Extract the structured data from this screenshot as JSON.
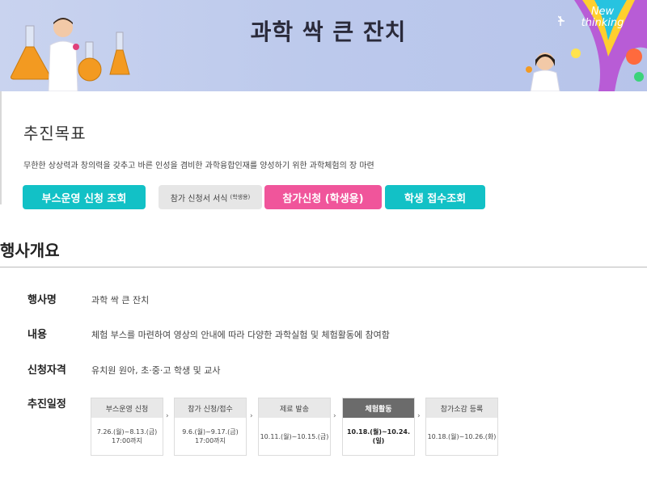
{
  "banner": {
    "title": "과학 싹 큰 잔치",
    "badge_line1": "New",
    "badge_line2": "thinking"
  },
  "goal": {
    "heading": "추진목표",
    "text": "무한한 상상력과 창의력을 갖추고 바른 인성을 겸비한 과학융합인재를 양성하기 위한 과학체험의 장 마련"
  },
  "buttons": {
    "booth": "부스운영 신청 조회",
    "form": "참가 신청서 서식",
    "form_small": "(학생용)",
    "apply": "참가신청 (학생용)",
    "check": "학생 접수조회"
  },
  "overview": {
    "heading": "행사개요",
    "rows": [
      {
        "label": "행사명",
        "value": "과학 싹 큰 잔치"
      },
      {
        "label": "내용",
        "value": "체험 부스를 마련하여 영상의 안내에 따라 다양한 과학실험 및 체험활동에 참여함"
      },
      {
        "label": "신청자격",
        "value": "유치원 원아, 초·중·고 학생 및 교사"
      },
      {
        "label": "추진일정",
        "value": ""
      }
    ]
  },
  "schedule": [
    {
      "title": "부스운영 신청",
      "line1": "7.26.(월)~8.13.(금)",
      "line2": "17:00까지",
      "active": false
    },
    {
      "title": "참가 신청/접수",
      "line1": "9.6.(월)~9.17.(금)",
      "line2": "17:00까지",
      "active": false
    },
    {
      "title": "제료 발송",
      "line1": "10.11.(월)~10.15.(금)",
      "line2": "",
      "active": false
    },
    {
      "title": "체험활동",
      "line1": "10.18.(월)~10.24.(일)",
      "line2": "",
      "active": true
    },
    {
      "title": "참가소감 등록",
      "line1": "10.18.(월)~10.26.(화)",
      "line2": "",
      "active": false
    }
  ],
  "arrow_glyph": "›",
  "colors": {
    "teal": "#12c1c6",
    "pink": "#f0559b",
    "banner": "#c0cbec"
  }
}
